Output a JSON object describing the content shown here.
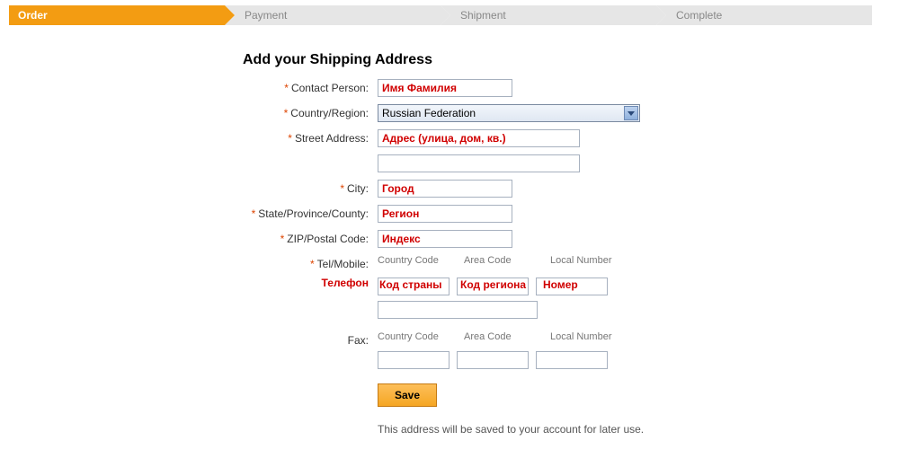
{
  "progress": {
    "steps": [
      "Order",
      "Payment",
      "Shipment",
      "Complete"
    ],
    "active_index": 0
  },
  "heading": "Add your Shipping Address",
  "labels": {
    "contact": "Contact Person:",
    "country": "Country/Region:",
    "street": "Street Address:",
    "city": "City:",
    "state": "State/Province/County:",
    "zip": "ZIP/Postal Code:",
    "tel": "Tel/Mobile:",
    "fax": "Fax:"
  },
  "phone_headers": {
    "country_code": "Country Code",
    "area_code": "Area Code",
    "local_number": "Local Number"
  },
  "values": {
    "contact": "Имя Фамилия",
    "country": "Russian Federation",
    "street1": "Адрес (улица, дом, кв.)",
    "street2": "",
    "city": "Город",
    "state": "Регион",
    "zip": "Индекс",
    "tel_country": "",
    "tel_area": "",
    "tel_local": "",
    "fax_country": "",
    "fax_area": "",
    "fax_local": ""
  },
  "ru_hints": {
    "tel_label": "Телефон",
    "tel_country": "Код страны",
    "tel_area": "Код региона",
    "tel_local": "Номер"
  },
  "buttons": {
    "save": "Save"
  },
  "note": "This address will be saved to your account for later use."
}
